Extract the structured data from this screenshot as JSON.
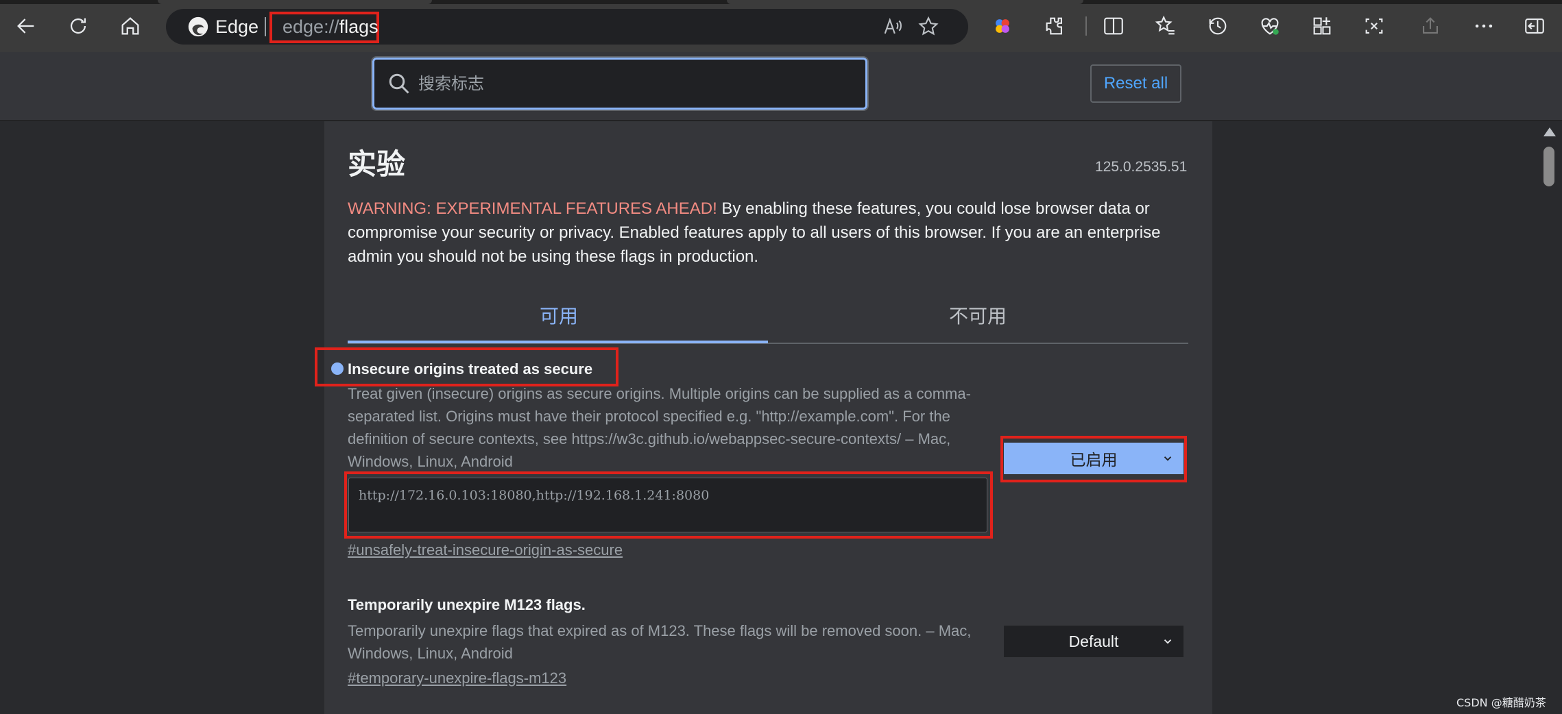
{
  "browser": {
    "name": "Edge",
    "url_prefix": "edge://",
    "url_highlight": "flags"
  },
  "header": {
    "search_placeholder": "搜索标志",
    "reset_label": "Reset all"
  },
  "page": {
    "title": "实验",
    "version": "125.0.2535.51",
    "warning_strong": "WARNING: EXPERIMENTAL FEATURES AHEAD!",
    "warning_text": " By enabling these features, you could lose browser data or compromise your security or privacy. Enabled features apply to all users of this browser. If you are an enterprise admin you should not be using these flags in production.",
    "tabs": [
      {
        "label": "可用"
      },
      {
        "label": "不可用"
      }
    ]
  },
  "flags": [
    {
      "title": "Insecure origins treated as secure",
      "description": "Treat given (insecure) origins as secure origins. Multiple origins can be supplied as a comma-separated list. Origins must have their protocol specified e.g. \"http://example.com\". For the definition of secure contexts, see https://w3c.github.io/webappsec-secure-contexts/ – Mac, Windows, Linux, Android",
      "input_value": "http://172.16.0.103:18080,http://192.168.1.241:8080",
      "link": "#unsafely-treat-insecure-origin-as-secure",
      "state": "已启用"
    },
    {
      "title": "Temporarily unexpire M123 flags.",
      "description": "Temporarily unexpire flags that expired as of M123. These flags will be removed soon. – Mac, Windows, Linux, Android",
      "link": "#temporary-unexpire-flags-m123",
      "state": "Default"
    }
  ],
  "watermark": "CSDN @糖醋奶茶",
  "colors": {
    "accent": "#8ab4f8",
    "warning": "#f28b82",
    "annotation": "#e0221b",
    "reset_link": "#4fa6ff"
  },
  "icons": [
    "back-icon",
    "refresh-icon",
    "home-icon",
    "edge-logo-icon",
    "read-aloud-icon",
    "favorite-star-icon",
    "copilot-icon",
    "extensions-icon",
    "split-screen-icon",
    "favorites-icon",
    "history-icon",
    "performance-icon",
    "collections-icon",
    "screenshot-icon",
    "share-icon",
    "more-icon",
    "sidebar-icon",
    "search-icon",
    "chevron-down-icon"
  ]
}
